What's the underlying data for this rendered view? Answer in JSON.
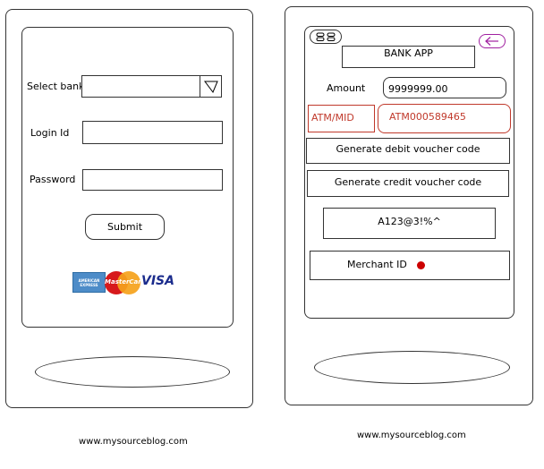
{
  "login_screen": {
    "select_bank_label": "Select bank",
    "select_bank_value": "",
    "login_id_label": "Login Id",
    "login_id_value": "",
    "password_label": "Password",
    "password_value": "",
    "submit_label": "Submit",
    "cards": {
      "amex": "AMERICAN EXPRESS",
      "mastercard": "MasterCard",
      "visa": "VISA"
    }
  },
  "bank_screen": {
    "title": "BANK APP",
    "amount_label": "Amount",
    "amount_value": "9999999.00",
    "atm_mid_label": "ATM/MID",
    "atm_mid_value": "ATM000589465",
    "debit_button_label": "Generate debit voucher code",
    "credit_button_label": "Generate credit voucher code",
    "voucher_code": "A123@3!%^",
    "merchant_id_label": "Merchant ID"
  },
  "footer": {
    "left_url": "www.mysourceblog.com",
    "right_url": "www.mysourceblog.com"
  },
  "colors": {
    "atm_red": "#c0392b",
    "back_arrow": "#a020a0",
    "merchant_dot": "#cc0000"
  }
}
